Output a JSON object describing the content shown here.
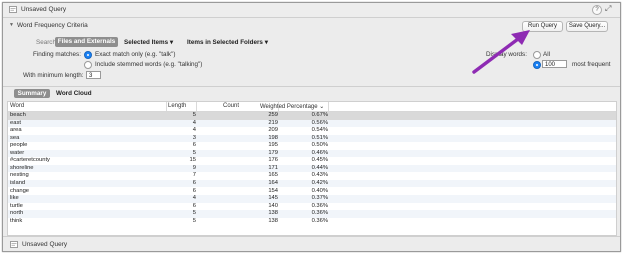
{
  "window": {
    "title": "Unsaved Query"
  },
  "criteria": {
    "title": "Word Frequency Criteria",
    "run_label": "Run Query",
    "save_label": "Save Query...",
    "search_in_label": "Search in:",
    "search_in_options": [
      "Files and Externals",
      "Selected Items",
      "Items in Selected Folders"
    ],
    "finding_matches_label": "Finding matches:",
    "match_exact": "Exact match only (e.g. \"talk\")",
    "match_stemmed": "Include stemmed words (e.g. \"talking\")",
    "min_length_label": "With minimum length:",
    "min_length_value": "3",
    "display_label": "Display words:",
    "display_all": "All",
    "display_count": "100",
    "display_suffix": "most frequent"
  },
  "tabs": {
    "summary": "Summary",
    "word_cloud": "Word Cloud"
  },
  "table": {
    "columns": [
      "Word",
      "Length",
      "Count",
      "Weighted Percentage"
    ],
    "rows": [
      [
        "beach",
        "5",
        "259",
        "0.67%"
      ],
      [
        "east",
        "4",
        "219",
        "0.56%"
      ],
      [
        "area",
        "4",
        "209",
        "0.54%"
      ],
      [
        "sea",
        "3",
        "198",
        "0.51%"
      ],
      [
        "people",
        "6",
        "195",
        "0.50%"
      ],
      [
        "water",
        "5",
        "179",
        "0.46%"
      ],
      [
        "#carteretcounty",
        "15",
        "176",
        "0.45%"
      ],
      [
        "shoreline",
        "9",
        "171",
        "0.44%"
      ],
      [
        "nesting",
        "7",
        "165",
        "0.43%"
      ],
      [
        "island",
        "6",
        "164",
        "0.42%"
      ],
      [
        "change",
        "6",
        "154",
        "0.40%"
      ],
      [
        "like",
        "4",
        "145",
        "0.37%"
      ],
      [
        "turtle",
        "6",
        "140",
        "0.36%"
      ],
      [
        "north",
        "5",
        "138",
        "0.36%"
      ],
      [
        "think",
        "5",
        "138",
        "0.36%"
      ]
    ]
  },
  "statusbar": {
    "title": "Unsaved Query"
  },
  "colors": {
    "accent": "#1a82f6",
    "annotation_arrow": "#8e2bb3",
    "selected_tab": "#8e8e8e"
  }
}
